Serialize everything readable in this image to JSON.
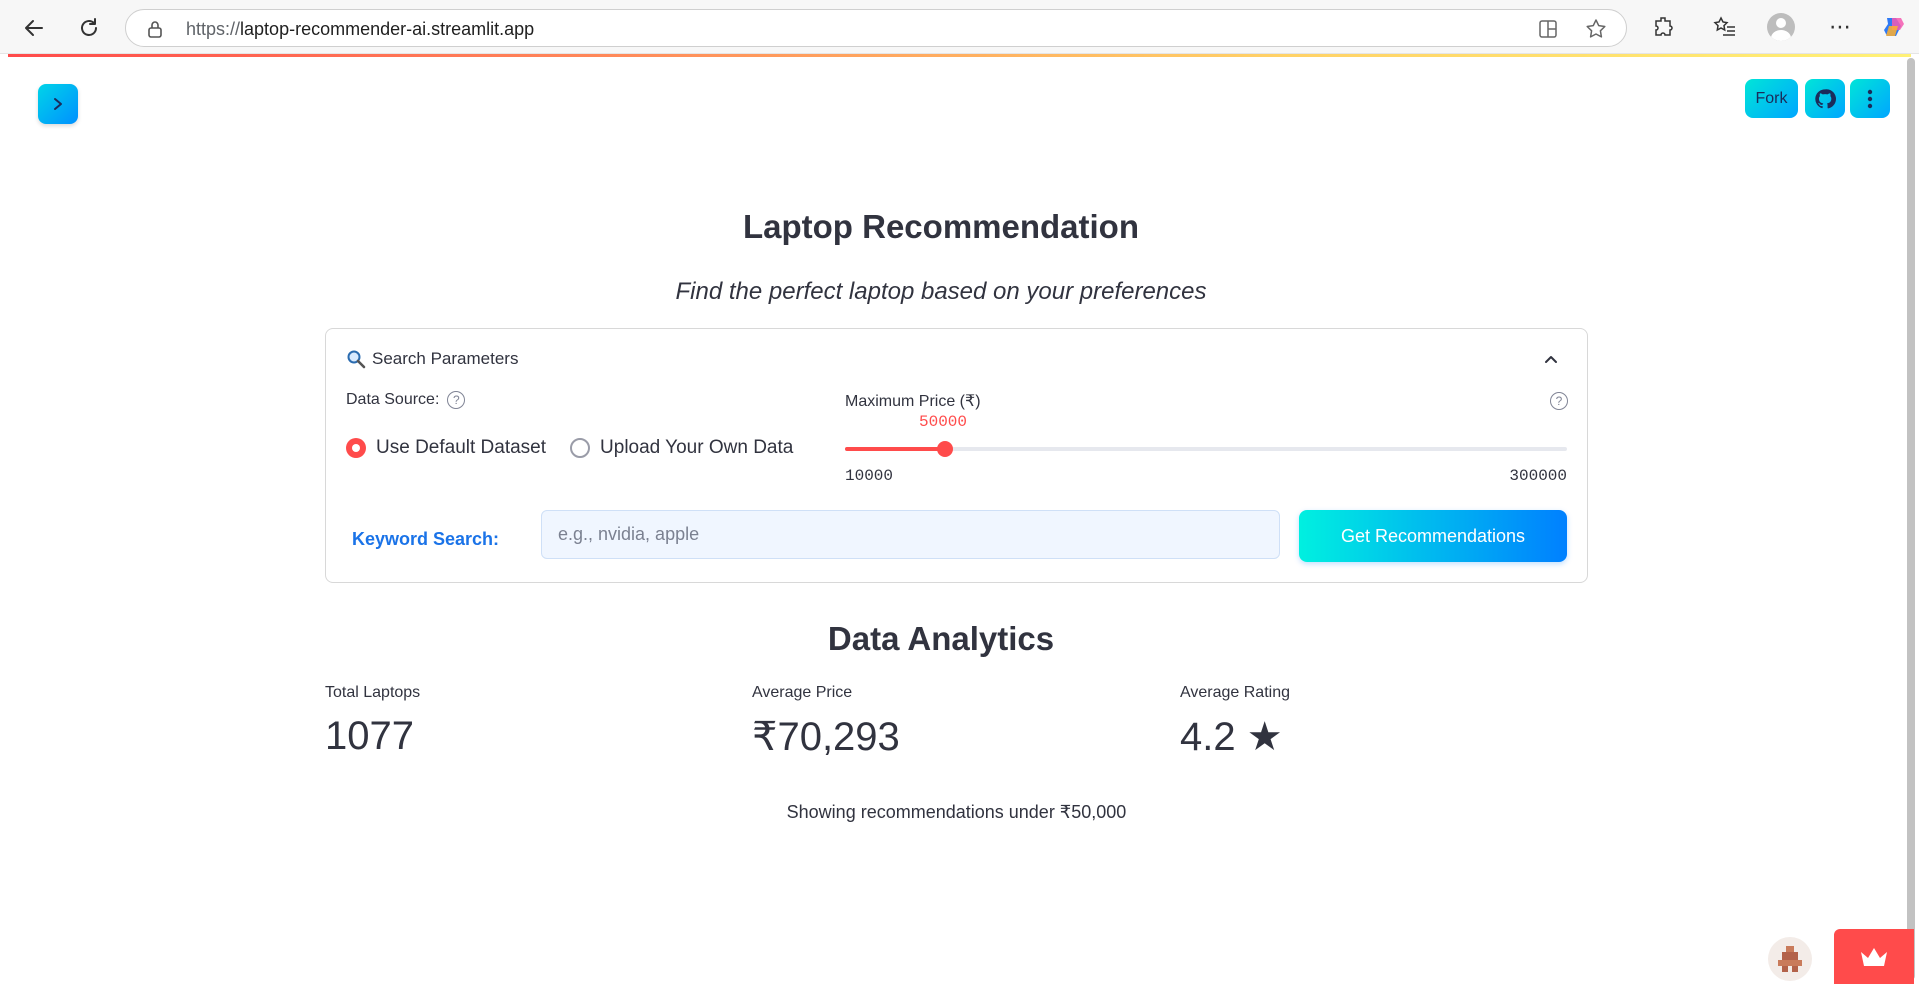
{
  "browser": {
    "url_protocol": "https://",
    "url_host": "laptop-recommender-ai.streamlit.app"
  },
  "app": {
    "fork_label": "Fork",
    "title": "Laptop Recommendation",
    "subtitle": "Find the perfect laptop based on your preferences"
  },
  "search_params": {
    "header": "Search Parameters",
    "data_source_label": "Data Source:",
    "radio_options": [
      "Use Default Dataset",
      "Upload Your Own Data"
    ],
    "selected_option": "Use Default Dataset",
    "max_price_label": "Maximum Price (₹)",
    "slider_value": "50000",
    "slider_min": "10000",
    "slider_max": "300000",
    "keyword_label": "Keyword Search:",
    "keyword_placeholder": "e.g., nvidia, apple",
    "keyword_value": "",
    "button_label": "Get Recommendations"
  },
  "analytics": {
    "title": "Data Analytics",
    "metrics": [
      {
        "label": "Total Laptops",
        "value": "1077"
      },
      {
        "label": "Average Price",
        "value": "₹70,293"
      },
      {
        "label": "Average Rating",
        "value": "4.2 ★"
      }
    ],
    "caption": "Showing recommendations under ₹50,000"
  },
  "icons": {
    "back": "back-arrow-icon",
    "refresh": "refresh-icon",
    "lock": "lock-icon",
    "search": "magnifier-icon",
    "chevron": "chevron-up-icon",
    "help": "question-circle-icon",
    "github": "github-icon",
    "menu": "vertical-dots-icon",
    "crown": "crown-icon"
  },
  "colors": {
    "accent": "#ff4b4b",
    "button_gradient_start": "#00f0e0",
    "button_gradient_end": "#0080ff",
    "keyword_label": "#1a73e8"
  }
}
